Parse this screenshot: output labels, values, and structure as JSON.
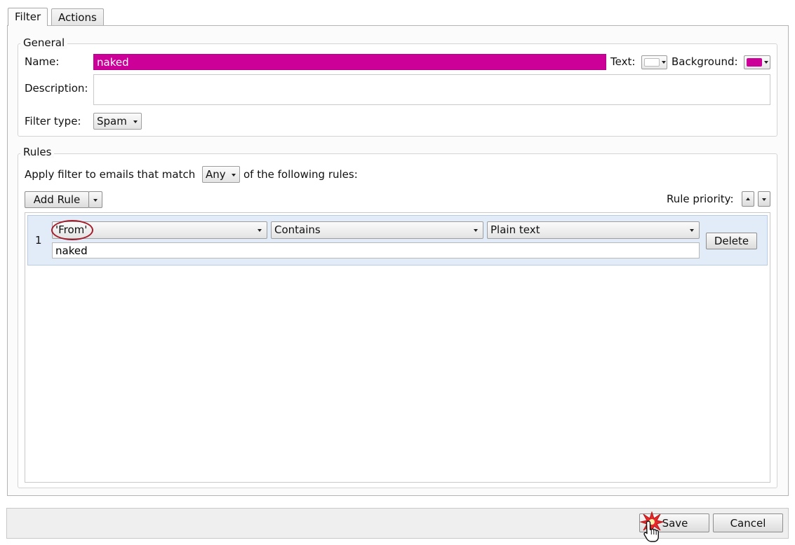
{
  "tabs": [
    {
      "label": "Filter",
      "active": true
    },
    {
      "label": "Actions",
      "active": false
    }
  ],
  "general": {
    "legend": "General",
    "name_label": "Name:",
    "name_value": "naked",
    "text_label": "Text:",
    "background_label": "Background:",
    "text_color": "#ffffff",
    "background_color": "#cc0099",
    "description_label": "Description:",
    "description_value": "",
    "filter_type_label": "Filter type:",
    "filter_type_value": "Spam"
  },
  "rules": {
    "legend": "Rules",
    "apply_prefix": "Apply filter to emails that match",
    "match_value": "Any",
    "apply_suffix": "of the following rules:",
    "add_rule_label": "Add Rule",
    "priority_label": "Rule priority:",
    "items": [
      {
        "index": "1",
        "field": "'From'",
        "condition": "Contains",
        "match_type": "Plain text",
        "value": "naked",
        "delete_label": "Delete"
      }
    ]
  },
  "footer": {
    "save_label": "Save",
    "cancel_label": "Cancel"
  }
}
